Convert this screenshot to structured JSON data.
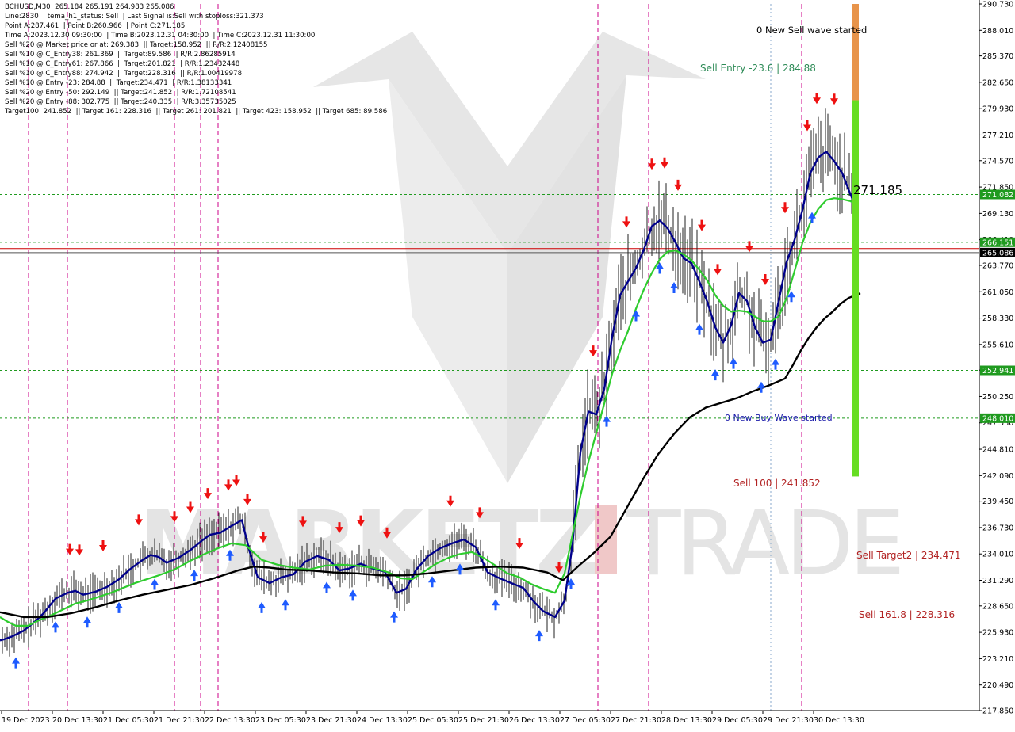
{
  "header": {
    "lines": [
      "BCHUSD,M30  265.184 265.191 264.983 265.086",
      "Line:2830  | tema_h1_status: Sell  | Last Signal is:Sell with stoploss:321.373",
      "Point A:287.461  | Point B:260.966  | Point C:271.185",
      "Time A:2023.12.30 09:30:00  | Time B:2023.12.31 04:30:00  | Time C:2023.12.31 11:30:00",
      "Sell %20 @ Market price or at: 269.383  || Target:158.952  || R/R:2.12408155",
      "Sell %10 @ C_Entry38: 261.369  || Target:89.586  | R/R:2.86285914",
      "Sell %10 @ C_Entry61: 267.866  || Target:201.821  | R/R:1.23432448",
      "Sell %10 @ C_Entry88: 274.942  || Target:228.316  || R/R:1.00419978",
      "Sell %10 @ Entry -23: 284.88  || Target:234.471  | R/R:1.38133341",
      "Sell %20 @ Entry -50: 292.149  || Target:241.852  | R/R:1.72108541",
      "Sell %20 @ Entry -88: 302.775  || Target:240.335  | R/R:3.35735025",
      "Target100: 241.852  || Target 161: 228.316  || Target 261: 201.821  || Target 423: 158.952  || Target 685: 89.586"
    ]
  },
  "watermark": {
    "left": "MARKETZ",
    "accent": "I",
    "right": "TRADE"
  },
  "annotations": {
    "sell_wave": "0 New Sell wave started",
    "buy_wave": "0 New Buy Wave started",
    "sell_entry": "Sell Entry -23.6 | 284.88",
    "point_c": "271.185",
    "sell_100": "Sell 100 | 241.852",
    "sell_target2": "Sell Target2 | 234.471",
    "sell_161": "Sell 161.8 | 228.316"
  },
  "colors": {
    "bull": "#22aa22",
    "bear": "#ee1111",
    "ma_blue": "#00008b",
    "ma_green": "#2ecc2e",
    "ma_black": "#000000",
    "price_line": "#cc0000",
    "level_line": "#1f9a1f",
    "vline": "#cc0088",
    "bar_green": "#66dd22",
    "bar_orange": "#e8944a"
  },
  "chart_data": {
    "type": "line",
    "symbol": "BCHUSD",
    "timeframe": "M30",
    "ylim": [
      217.85,
      290.73
    ],
    "yticks": [
      "290.730",
      "288.010",
      "285.370",
      "282.650",
      "279.930",
      "277.210",
      "274.570",
      "271.850",
      "269.130",
      "266.410",
      "263.770",
      "261.050",
      "258.330",
      "255.610",
      "252.970",
      "250.250",
      "247.530",
      "244.810",
      "242.090",
      "239.450",
      "236.730",
      "234.010",
      "231.290",
      "228.650",
      "225.930",
      "223.210",
      "220.490",
      "217.850"
    ],
    "xticks": [
      "19 Dec 2023",
      "20 Dec 13:30",
      "21 Dec 05:30",
      "21 Dec 21:30",
      "22 Dec 13:30",
      "23 Dec 05:30",
      "23 Dec 21:30",
      "24 Dec 13:30",
      "25 Dec 05:30",
      "25 Dec 21:30",
      "26 Dec 13:30",
      "27 Dec 05:30",
      "27 Dec 21:30",
      "28 Dec 13:30",
      "29 Dec 05:30",
      "29 Dec 21:30",
      "30 Dec 13:30"
    ],
    "price_labels": [
      {
        "label": "271.082",
        "value": 271.082,
        "color": "#1f9a1f"
      },
      {
        "label": "266.151",
        "value": 266.151,
        "color": "#1f9a1f"
      },
      {
        "label": "265.086",
        "value": 265.086,
        "color": "#000000"
      },
      {
        "label": "252.941",
        "value": 252.941,
        "color": "#1f9a1f"
      },
      {
        "label": "248.010",
        "value": 248.01,
        "color": "#1f9a1f"
      }
    ],
    "horizontal_levels": [
      {
        "value": 271.082,
        "style": "dashed",
        "color": "#1f9a1f"
      },
      {
        "value": 266.151,
        "style": "dashed",
        "color": "#1f9a1f"
      },
      {
        "value": 265.5,
        "style": "solid",
        "color": "#cc0000"
      },
      {
        "value": 265.086,
        "style": "solid",
        "color": "#555555"
      },
      {
        "value": 252.941,
        "style": "dashed",
        "color": "#1f9a1f"
      },
      {
        "value": 248.01,
        "style": "dashed",
        "color": "#1f9a1f"
      }
    ],
    "target_bar": {
      "top_orange": 290.73,
      "orange_to_green": 280.8,
      "bottom": 242.0
    },
    "series": [
      {
        "color": "#00008b",
        "x": [
          0,
          5,
          15,
          30,
          45,
          55,
          70,
          85,
          95,
          105,
          120,
          135,
          150,
          165,
          180,
          190,
          200,
          210,
          225,
          240,
          255,
          265,
          278,
          292,
          305,
          315,
          325,
          340,
          355,
          370,
          385,
          400,
          415,
          428,
          440,
          455,
          470,
          485,
          500,
          512,
          525,
          540,
          555,
          570,
          585,
          600,
          615,
          630,
          645,
          660,
          672,
          685,
          700,
          712,
          722,
          732,
          742,
          752,
          762,
          772,
          782,
          792,
          802,
          812,
          822,
          832,
          842,
          852,
          862,
          872,
          882,
          892,
          902,
          912,
          922,
          932,
          942,
          952,
          962,
          972,
          982,
          992,
          1002,
          1012,
          1022,
          1032,
          1042,
          1052,
          1062,
          1072,
          1082
        ],
        "y": [
          225.1,
          225.2,
          225.5,
          226.1,
          227.1,
          227.9,
          229.4,
          230.0,
          230.2,
          229.8,
          230.1,
          230.6,
          231.4,
          232.5,
          233.4,
          233.9,
          233.7,
          233.1,
          233.6,
          234.4,
          235.4,
          236.0,
          236.2,
          236.9,
          237.5,
          234.2,
          231.6,
          231.0,
          231.6,
          231.9,
          233.2,
          233.8,
          233.4,
          232.3,
          232.5,
          233.0,
          232.5,
          232.2,
          230.0,
          230.4,
          232.4,
          233.8,
          234.6,
          235.1,
          235.5,
          234.7,
          232.1,
          231.5,
          231.0,
          230.5,
          229.2,
          228.1,
          227.5,
          229.2,
          235.0,
          244.5,
          248.7,
          248.4,
          251.0,
          256.4,
          260.7,
          262.1,
          263.5,
          265.4,
          267.8,
          268.4,
          267.6,
          266.1,
          264.5,
          264.0,
          262.1,
          260.0,
          257.4,
          255.8,
          257.6,
          260.9,
          260.1,
          257.4,
          255.8,
          256.1,
          260.1,
          264.1,
          266.4,
          269.5,
          273.3,
          274.9,
          275.5,
          274.5,
          273.3,
          271.2,
          269.2
        ]
      },
      {
        "color": "#2ecc2e",
        "x": [
          0,
          10,
          20,
          35,
          50,
          65,
          80,
          95,
          110,
          125,
          140,
          155,
          170,
          185,
          200,
          220,
          240,
          258,
          275,
          292,
          310,
          330,
          350,
          370,
          390,
          410,
          430,
          450,
          470,
          490,
          505,
          520,
          535,
          550,
          565,
          580,
          595,
          610,
          625,
          640,
          655,
          670,
          685,
          700,
          712,
          722,
          732,
          742,
          752,
          762,
          772,
          782,
          792,
          802,
          812,
          822,
          832,
          842,
          852,
          862,
          872,
          882,
          892,
          902,
          912,
          922,
          932,
          942,
          952,
          962,
          972,
          982,
          992,
          1002,
          1012,
          1022,
          1032,
          1042,
          1052,
          1062,
          1072,
          1082
        ],
        "y": [
          227.5,
          227.0,
          226.6,
          226.6,
          227.2,
          227.7,
          228.3,
          228.9,
          229.2,
          229.6,
          230.0,
          230.5,
          231.0,
          231.4,
          231.8,
          232.4,
          233.3,
          234.0,
          234.6,
          235.1,
          234.9,
          233.4,
          232.9,
          232.6,
          232.4,
          232.8,
          232.9,
          232.8,
          232.6,
          232.1,
          231.5,
          231.4,
          232.2,
          233.0,
          233.6,
          234.0,
          234.2,
          233.6,
          232.8,
          232.0,
          231.6,
          230.9,
          230.4,
          230.0,
          232.0,
          236.0,
          240.0,
          243.5,
          246.5,
          249.5,
          252.6,
          255.0,
          257.0,
          259.3,
          261.3,
          263.0,
          264.4,
          265.2,
          265.3,
          264.9,
          264.3,
          263.3,
          262.2,
          260.7,
          259.6,
          259.0,
          259.1,
          259.0,
          258.5,
          258.0,
          258.0,
          258.5,
          260.4,
          263.2,
          266.1,
          268.2,
          269.6,
          270.5,
          270.7,
          270.6,
          270.4,
          270.0
        ]
      },
      {
        "color": "#000000",
        "x": [
          0,
          30,
          60,
          90,
          120,
          150,
          180,
          210,
          240,
          270,
          300,
          320,
          340,
          360,
          390,
          420,
          450,
          480,
          510,
          540,
          570,
          600,
          630,
          660,
          690,
          710,
          730,
          750,
          770,
          790,
          810,
          830,
          850,
          870,
          890,
          910,
          930,
          950,
          970,
          990,
          1000,
          1010,
          1020,
          1030,
          1040,
          1050,
          1060,
          1070,
          1085
        ],
        "y": [
          228.0,
          227.5,
          227.5,
          227.9,
          228.5,
          229.2,
          229.8,
          230.3,
          230.8,
          231.5,
          232.3,
          232.7,
          232.6,
          232.4,
          232.3,
          232.1,
          232.0,
          231.8,
          231.8,
          232.0,
          232.3,
          232.6,
          232.7,
          232.6,
          232.1,
          231.3,
          232.8,
          234.2,
          235.8,
          238.7,
          241.6,
          244.3,
          246.4,
          248.1,
          249.1,
          249.6,
          250.1,
          250.8,
          251.4,
          252.1,
          253.5,
          255.0,
          256.3,
          257.4,
          258.3,
          259.0,
          259.8,
          260.4,
          260.9
        ]
      }
    ]
  }
}
